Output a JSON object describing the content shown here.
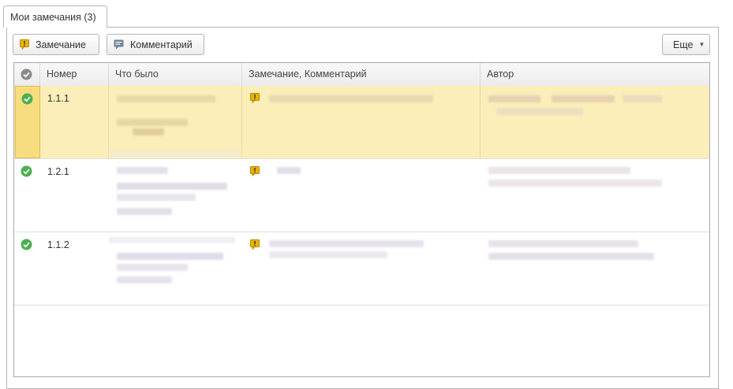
{
  "tab": {
    "label": "Мои замечания (3)"
  },
  "toolbar": {
    "remark_label": "Замечание",
    "comment_label": "Комментарий",
    "more_label": "Еще"
  },
  "table": {
    "columns": {
      "number": "Номер",
      "what_was": "Что было",
      "remark_comment": "Замечание, Комментарий",
      "author": "Автор"
    },
    "rows": [
      {
        "number": "1.1.1",
        "status": "done",
        "selected": true
      },
      {
        "number": "1.2.1",
        "status": "done",
        "selected": false
      },
      {
        "number": "1.1.2",
        "status": "done",
        "selected": false
      }
    ]
  },
  "colors": {
    "selected_row": "#fbeeb8",
    "status_green": "#4caf50",
    "remark_yellow": "#e6b400"
  }
}
